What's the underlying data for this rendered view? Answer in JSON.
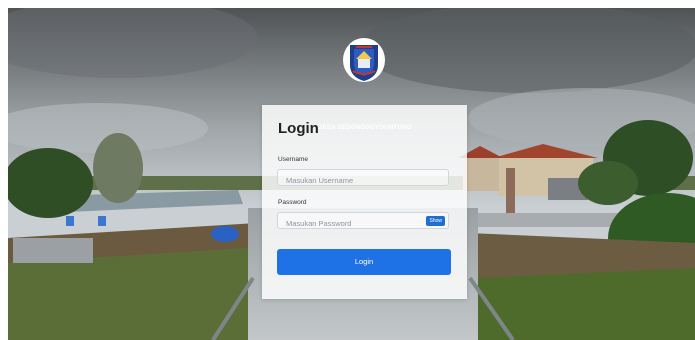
{
  "login": {
    "title": "Login",
    "watermark": "DESA SEDONGDOYOUNTUNG",
    "username_label": "Username",
    "username_placeholder": "Masukan Username",
    "password_label": "Password",
    "password_placeholder": "Masukan Password",
    "show_label": "Show",
    "submit_label": "Login"
  },
  "colors": {
    "button_primary": "#1f72e6",
    "card_background": "#ffffff"
  },
  "icons": {
    "emblem": "village-emblem-icon"
  }
}
